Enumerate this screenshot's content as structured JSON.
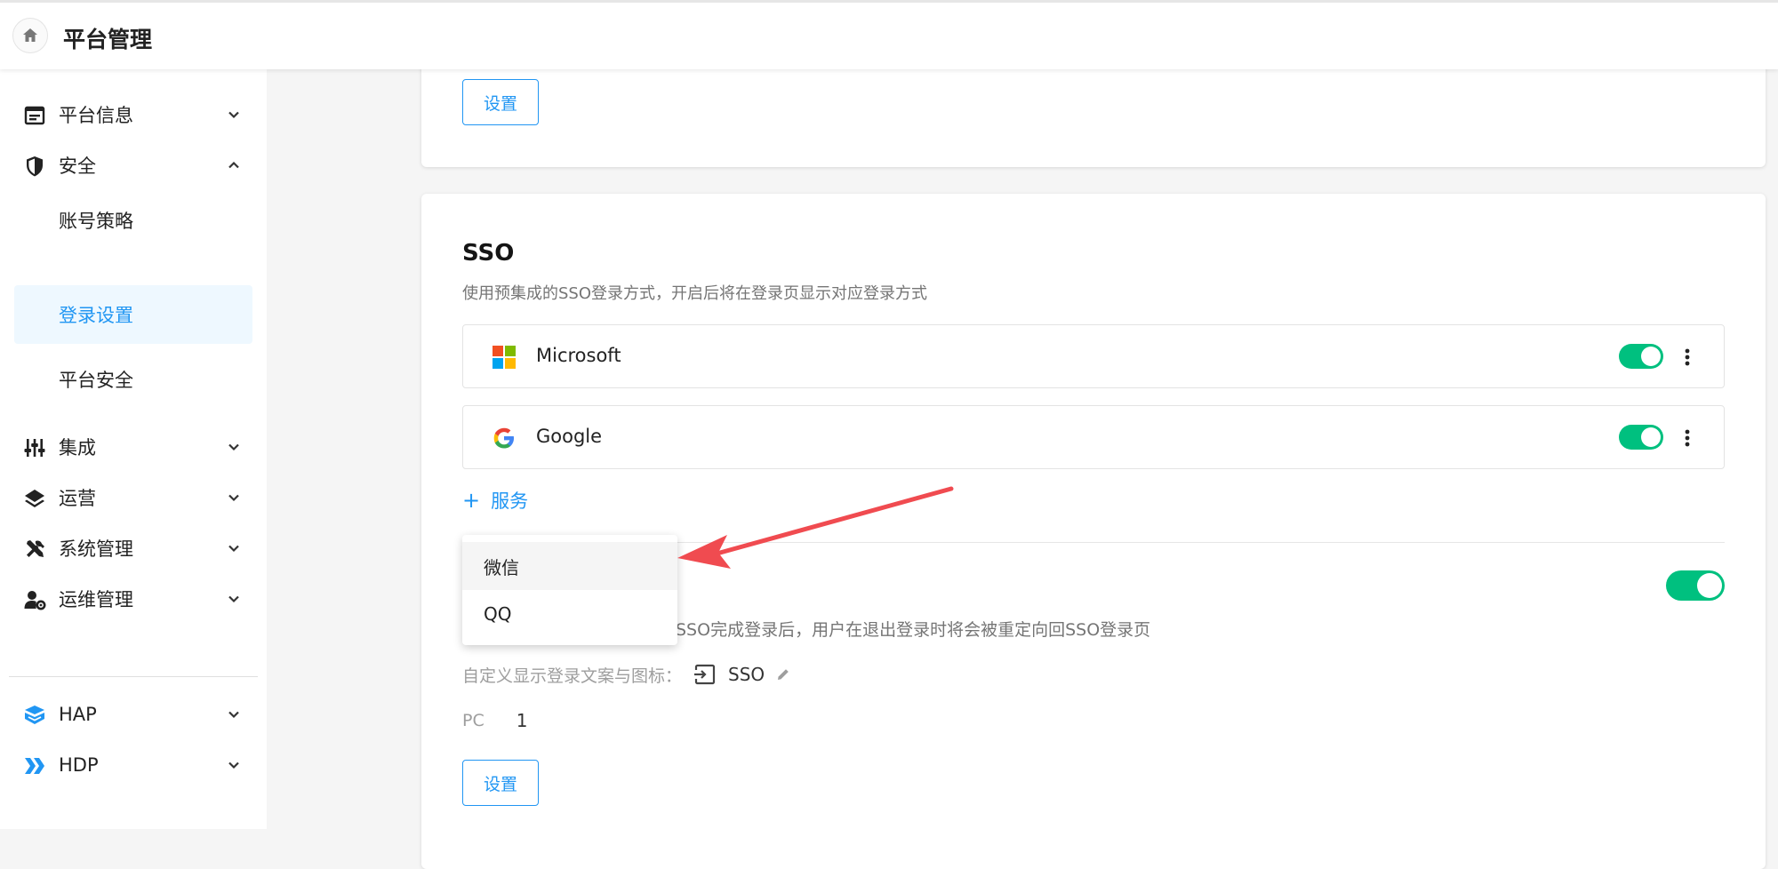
{
  "header": {
    "title": "平台管理",
    "home_icon": "home-icon"
  },
  "sidebar": {
    "items": [
      {
        "label": "平台信息",
        "icon": "document-icon",
        "expanded": false
      },
      {
        "label": "安全",
        "icon": "shield-icon",
        "expanded": true,
        "children": [
          {
            "label": "账号策略",
            "active": false
          },
          {
            "label": "登录设置",
            "active": true
          },
          {
            "label": "平台安全",
            "active": false
          }
        ]
      },
      {
        "label": "集成",
        "icon": "sliders-icon",
        "expanded": false
      },
      {
        "label": "运营",
        "icon": "layers-icon",
        "expanded": false
      },
      {
        "label": "系统管理",
        "icon": "tools-icon",
        "expanded": false
      },
      {
        "label": "运维管理",
        "icon": "user-gear-icon",
        "expanded": false
      },
      {
        "label": "HAP",
        "icon": "hap-logo-icon",
        "expanded": false
      },
      {
        "label": "HDP",
        "icon": "hdp-logo-icon",
        "expanded": false
      }
    ]
  },
  "top_card": {
    "settings_button": "设置"
  },
  "sso": {
    "title": "SSO",
    "description": "使用预集成的SSO登录方式，开启后将在登录页显示对应登录方式",
    "providers": [
      {
        "name": "Microsoft",
        "icon": "microsoft-logo-icon",
        "enabled": true
      },
      {
        "name": "Google",
        "icon": "google-logo-icon",
        "enabled": true
      }
    ],
    "add_service_label": "服务",
    "dropdown_options": [
      "微信",
      "QQ"
    ],
    "logout_description": "SSO完成登录后，用户在退出登录时将会被重定向回SSO登录页",
    "logout_toggle_enabled": true,
    "custom_label": "自定义显示登录文案与图标：",
    "custom_value": "SSO",
    "pc_label": "PC",
    "pc_value": "1",
    "settings_button": "设置"
  },
  "colors": {
    "accent": "#2196f3",
    "toggle_on": "#00c07f",
    "active_bg": "#eef8ff",
    "annotation_arrow": "#f04b50"
  }
}
